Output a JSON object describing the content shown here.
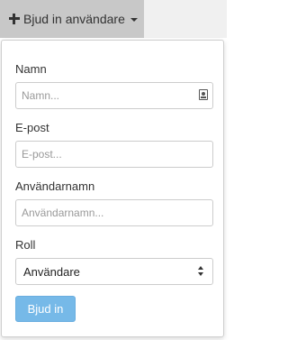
{
  "toolbar": {
    "invite_button_label": "Bjud in användare",
    "icons": [
      "plus-icon",
      "caret-down-icon"
    ]
  },
  "form": {
    "name": {
      "label": "Namn",
      "placeholder": "Namn...",
      "value": "",
      "icon": "contact-card-icon"
    },
    "email": {
      "label": "E-post",
      "placeholder": "E-post...",
      "value": ""
    },
    "username": {
      "label": "Användarnamn",
      "placeholder": "Användarnamn...",
      "value": ""
    },
    "role": {
      "label": "Roll",
      "selected": "Användare",
      "icon": "up-down-arrows-icon"
    },
    "submit_label": "Bjud in"
  },
  "colors": {
    "submit_button": "#76b9e8",
    "toolbar_button": "#c8c8c8"
  }
}
